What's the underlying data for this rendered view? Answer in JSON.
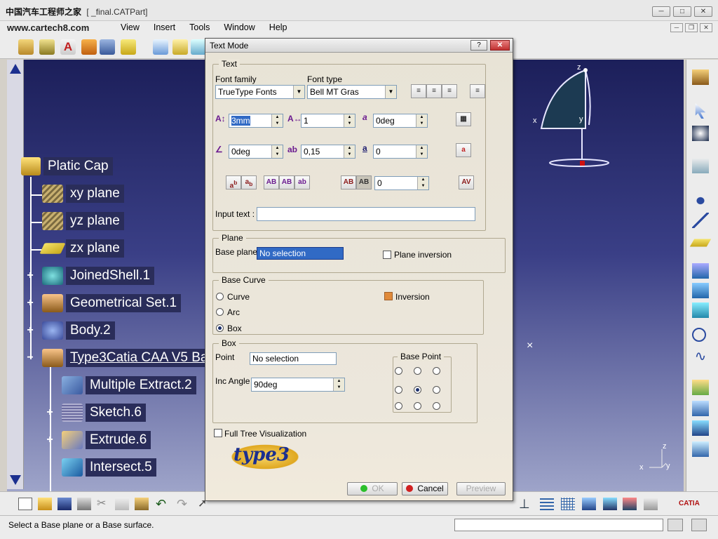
{
  "window": {
    "title": "[ _final.CATPart]",
    "watermark_line1": "中国汽车工程师之家",
    "watermark_line2": "www.cartech8.com",
    "buttons": {
      "minimize": "─",
      "maximize": "□",
      "close": "✕"
    }
  },
  "menubar": {
    "items": [
      "View",
      "Insert",
      "Tools",
      "Window",
      "Help"
    ]
  },
  "tree": {
    "root": "Platic Cap",
    "items": [
      {
        "label": "xy plane",
        "expander": ""
      },
      {
        "label": "yz plane",
        "expander": ""
      },
      {
        "label": "zx plane",
        "expander": ""
      },
      {
        "label": "JoinedShell.1",
        "expander": "+"
      },
      {
        "label": "Geometrical Set.1",
        "expander": "+"
      },
      {
        "label": "Body.2",
        "expander": "+"
      },
      {
        "label": "Type3Catia CAA V5 Ba",
        "expander": "−"
      },
      {
        "label": "Multiple Extract.2",
        "expander": ""
      },
      {
        "label": "Sketch.6",
        "expander": "+"
      },
      {
        "label": "Extrude.6",
        "expander": "+"
      },
      {
        "label": "Intersect.5",
        "expander": ""
      }
    ]
  },
  "viewport": {
    "axis_z": "z",
    "axis_x": "x",
    "axis_y": "y",
    "compass_z": "z",
    "compass_x": "x",
    "compass_y": "y"
  },
  "statusbar": {
    "message": "Select a Base plane or a Base surface."
  },
  "dialog": {
    "title": "Text Mode",
    "help": "?",
    "close": "✕",
    "text_group": {
      "title": "Text",
      "font_family_label": "Font family",
      "font_family_value": "TrueType Fonts",
      "font_type_label": "Font type",
      "font_type_value": "Bell MT Gras",
      "height_value": "3mm",
      "ratio_value": "1",
      "slant_value": "0deg",
      "angle_value": "0deg",
      "spacing_value": "0,15",
      "offset_value": "0",
      "kerning_value": "0",
      "input_text_label": "Input text :",
      "input_text_value": ""
    },
    "plane_group": {
      "title": "Plane",
      "base_plane_label": "Base plane",
      "base_plane_value": "No selection",
      "plane_inversion_label": "Plane inversion",
      "plane_inversion_checked": false
    },
    "base_curve_group": {
      "title": "Base Curve",
      "options": [
        "Curve",
        "Arc",
        "Box"
      ],
      "selected": "Box",
      "inversion_label": "Inversion",
      "inversion_checked": true
    },
    "box_group": {
      "title": "Box",
      "point_label": "Point",
      "point_value": "No selection",
      "inc_angle_label": "Inc Angle",
      "inc_angle_value": "90deg",
      "base_point_title": "Base Point",
      "base_point_selected": "middle-center"
    },
    "full_tree_label": "Full Tree Visualization",
    "full_tree_checked": false,
    "logo_text": "type3",
    "buttons": {
      "ok": "OK",
      "cancel": "Cancel",
      "preview": "Preview"
    }
  },
  "colors": {
    "accent": "#316ac5",
    "close_red": "#c03030",
    "tree_label_bg": "#2a2d5a"
  }
}
